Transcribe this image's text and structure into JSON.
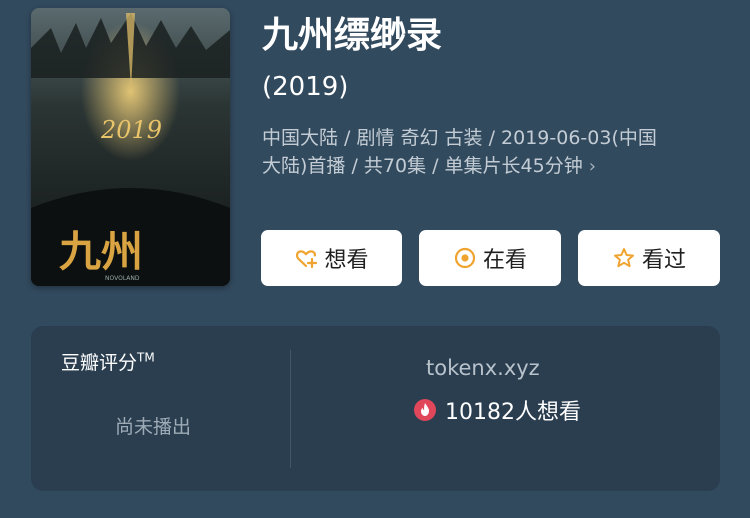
{
  "title": "九州缥缈录",
  "year": "(2019)",
  "meta": {
    "line1": "中国大陆 / 剧情 奇幻 古装 / 2019-06-03(中国",
    "line2": "大陆)首播 / 共70集 / 单集片长45分钟",
    "chevron": "›"
  },
  "poster": {
    "year_text": "2019",
    "art_title": "九州",
    "small_text": "NOVOLAND"
  },
  "actions": {
    "want": {
      "label": "想看",
      "icon": "heart-plus-icon"
    },
    "watching": {
      "label": "在看",
      "icon": "target-circle-icon"
    },
    "watched": {
      "label": "看过",
      "icon": "star-icon"
    }
  },
  "rating": {
    "label": "豆瓣评分",
    "trademark": "TM",
    "status": "尚未播出",
    "watermark": "tokenx.xyz",
    "want_count": "10182人想看",
    "flame_icon": "flame-icon"
  },
  "colors": {
    "background": "#324a5e",
    "card": "#2a3e50",
    "accent_orange": "#f0a430",
    "flame_red": "#e0475a"
  }
}
